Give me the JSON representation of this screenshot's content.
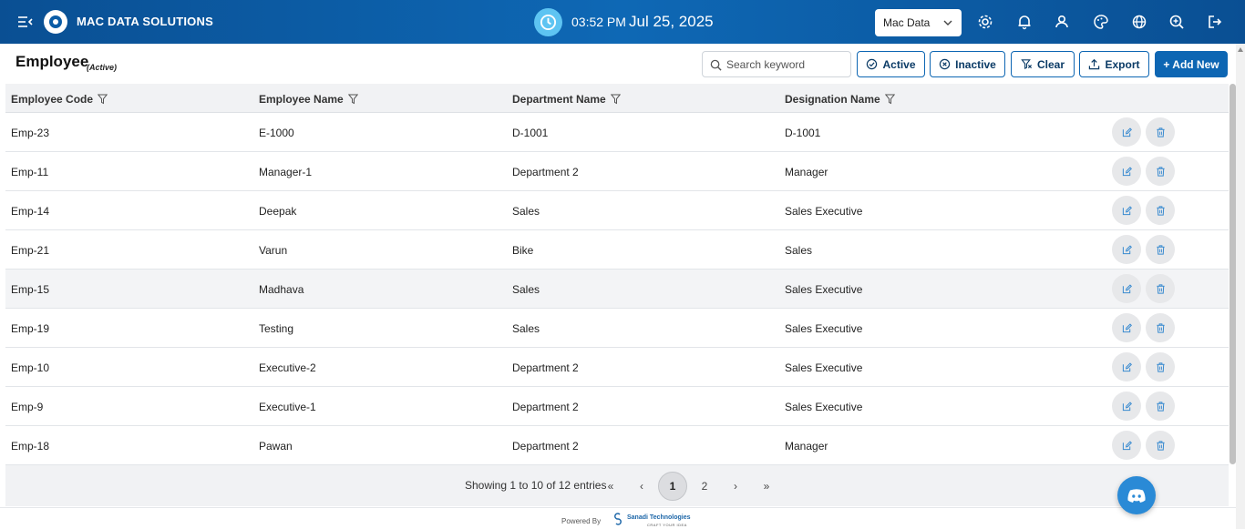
{
  "header": {
    "brand": "MAC DATA SOLUTIONS",
    "time": "03:52 PM",
    "date": "Jul 25, 2025",
    "company_select": "Mac Data",
    "icons": [
      "menu-collapse-icon",
      "settings-icon",
      "bell-icon",
      "user-icon",
      "palette-icon",
      "globe-icon",
      "zoom-in-icon",
      "logout-icon"
    ]
  },
  "page": {
    "title": "Employee",
    "subtitle": "(Active)"
  },
  "toolbar": {
    "search_placeholder": "Search keyword",
    "active_label": "Active",
    "inactive_label": "Inactive",
    "clear_label": "Clear",
    "export_label": "Export",
    "add_new_label": "+ Add New"
  },
  "table": {
    "columns": [
      "Employee Code",
      "Employee Name",
      "Department Name",
      "Designation Name"
    ],
    "rows": [
      {
        "code": "Emp-23",
        "name": "E-1000",
        "department": "D-1001",
        "designation": "D-1001"
      },
      {
        "code": "Emp-11",
        "name": "Manager-1",
        "department": "Department 2",
        "designation": "Manager"
      },
      {
        "code": "Emp-14",
        "name": "Deepak",
        "department": "Sales",
        "designation": "Sales Executive"
      },
      {
        "code": "Emp-21",
        "name": "Varun",
        "department": "Bike",
        "designation": "Sales"
      },
      {
        "code": "Emp-15",
        "name": "Madhava",
        "department": "Sales",
        "designation": "Sales Executive"
      },
      {
        "code": "Emp-19",
        "name": "Testing",
        "department": "Sales",
        "designation": "Sales Executive"
      },
      {
        "code": "Emp-10",
        "name": "Executive-2",
        "department": "Department 2",
        "designation": "Sales Executive"
      },
      {
        "code": "Emp-9",
        "name": "Executive-1",
        "department": "Department 2",
        "designation": "Sales Executive"
      },
      {
        "code": "Emp-18",
        "name": "Pawan",
        "department": "Department 2",
        "designation": "Manager"
      }
    ]
  },
  "pagination": {
    "info": "Showing 1 to 10 of 12 entries",
    "first": "«",
    "prev": "‹",
    "pages": [
      "1",
      "2"
    ],
    "current_page": "1",
    "next": "›",
    "last": "»"
  },
  "footer": {
    "powered_by": "Powered By",
    "company": "Sanadi Technologies",
    "tagline": "CRAFT YOUR IDEA"
  },
  "colors": {
    "header_bg": "#0e68b5",
    "primary": "#0d66b3",
    "clock_bg": "#5ec4f2",
    "discord_bg": "#2a8ad6",
    "row_highlight": "#f3f4f6"
  }
}
